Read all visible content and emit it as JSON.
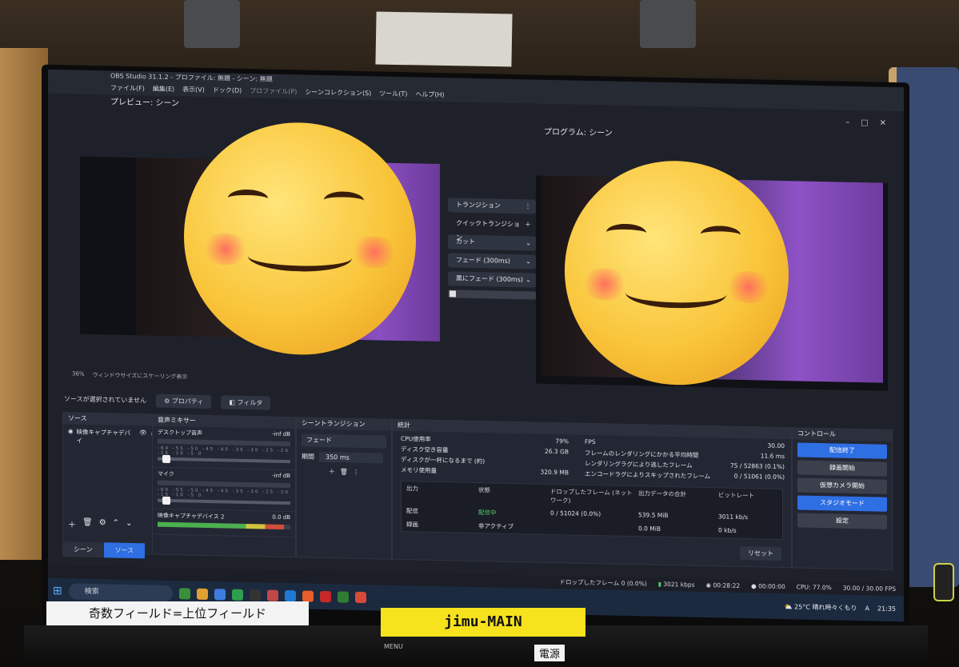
{
  "window": {
    "title": "OBS Studio 31.1.2 - プロファイル: 無題 - シーン: 無題"
  },
  "menu": [
    "ファイル(F)",
    "編集(E)",
    "表示(V)",
    "ドック(D)",
    "プロファイル(P)",
    "シーンコレクション(S)",
    "ツール(T)",
    "ヘルプ(H)"
  ],
  "preview": {
    "label": "プレビュー: シーン",
    "zoom": "36%",
    "scale_mode": "ウィンドウサイズにスケーリング表示"
  },
  "program": {
    "label": "プログラム: シーン"
  },
  "transition_panel": {
    "transition_btn": "トランジション",
    "quick_label": "クイックトランジション",
    "items": [
      "カット",
      "フェード (300ms)",
      "黒にフェード (300ms)"
    ]
  },
  "source_bar": {
    "no_source": "ソースが選択されていません",
    "properties": "プロパティ",
    "filters": "フィルタ"
  },
  "sources": {
    "header": "ソース",
    "item": "映像キャプチャデバイ"
  },
  "mixer": {
    "header": "音声ミキサー",
    "scale": "-60 -55 -50 -45 -40 -35 -30 -25 -20 -15 -10 -5 0",
    "channels": [
      {
        "name": "デスクトップ音声",
        "level": "-inf dB",
        "fill": 0
      },
      {
        "name": "マイク",
        "level": "-inf dB",
        "fill": 0
      },
      {
        "name": "映像キャプチャデバイス 2",
        "level": "0.0 dB",
        "fill": 0.95
      }
    ]
  },
  "scene_transitions": {
    "header": "シーントランジション",
    "selected": "フェード",
    "duration_label": "期間",
    "duration": "350 ms"
  },
  "stats": {
    "header": "統計",
    "cpu_label": "CPU使用率",
    "cpu": "79%",
    "disk_label": "ディスク空き容量",
    "disk": "26.3 GB",
    "disk_full_label": "ディスクが一杯になるまで (約)",
    "disk_full": "",
    "mem_label": "メモリ使用量",
    "mem": "320.9 MB",
    "fps_label": "FPS",
    "fps": "30.00",
    "render_label": "フレームのレンダリングにかかる平均時間",
    "render": "11.6 ms",
    "lag_label": "レンダリングラグにより逃したフレーム",
    "lag": "75 / 52863 (0.1%)",
    "enc_label": "エンコードラグによりスキップされたフレーム",
    "enc": "0 / 51061 (0.0%)",
    "table_headers": [
      "出力",
      "状態",
      "ドロップしたフレーム (ネットワーク)",
      "出力データの合計",
      "ビットレート"
    ],
    "rows": [
      [
        "配信",
        "配信中",
        "0 / 51024 (0.0%)",
        "539.5 MiB",
        "3011 kb/s"
      ],
      [
        "録画",
        "非アクティブ",
        "",
        "0.0 MiB",
        "0 kb/s"
      ]
    ],
    "reset": "リセット"
  },
  "controls": {
    "header": "コントロール",
    "buttons": [
      "配信終了",
      "録画開始",
      "仮想カメラ開始",
      "スタジオモード",
      "設定"
    ]
  },
  "dock_tabs": [
    "シーン",
    "ソース"
  ],
  "statusbar": {
    "dropped": "ドロップしたフレーム 0 (0.0%)",
    "bitrate": "3021 kbps",
    "live_time": "00:28:22",
    "rec_time": "00:00:00",
    "cpu": "CPU: 77.0%",
    "fps": "30.00 / 30.00 FPS"
  },
  "taskbar": {
    "search": "検索",
    "weather": "25°C 晴れ時々くもり",
    "time": "21:35",
    "ime": "A"
  },
  "labels": {
    "white": "奇数フィールド=上位フィールド",
    "yellow": "jimu-MAIN",
    "menu": "MENU",
    "power": "電源"
  }
}
